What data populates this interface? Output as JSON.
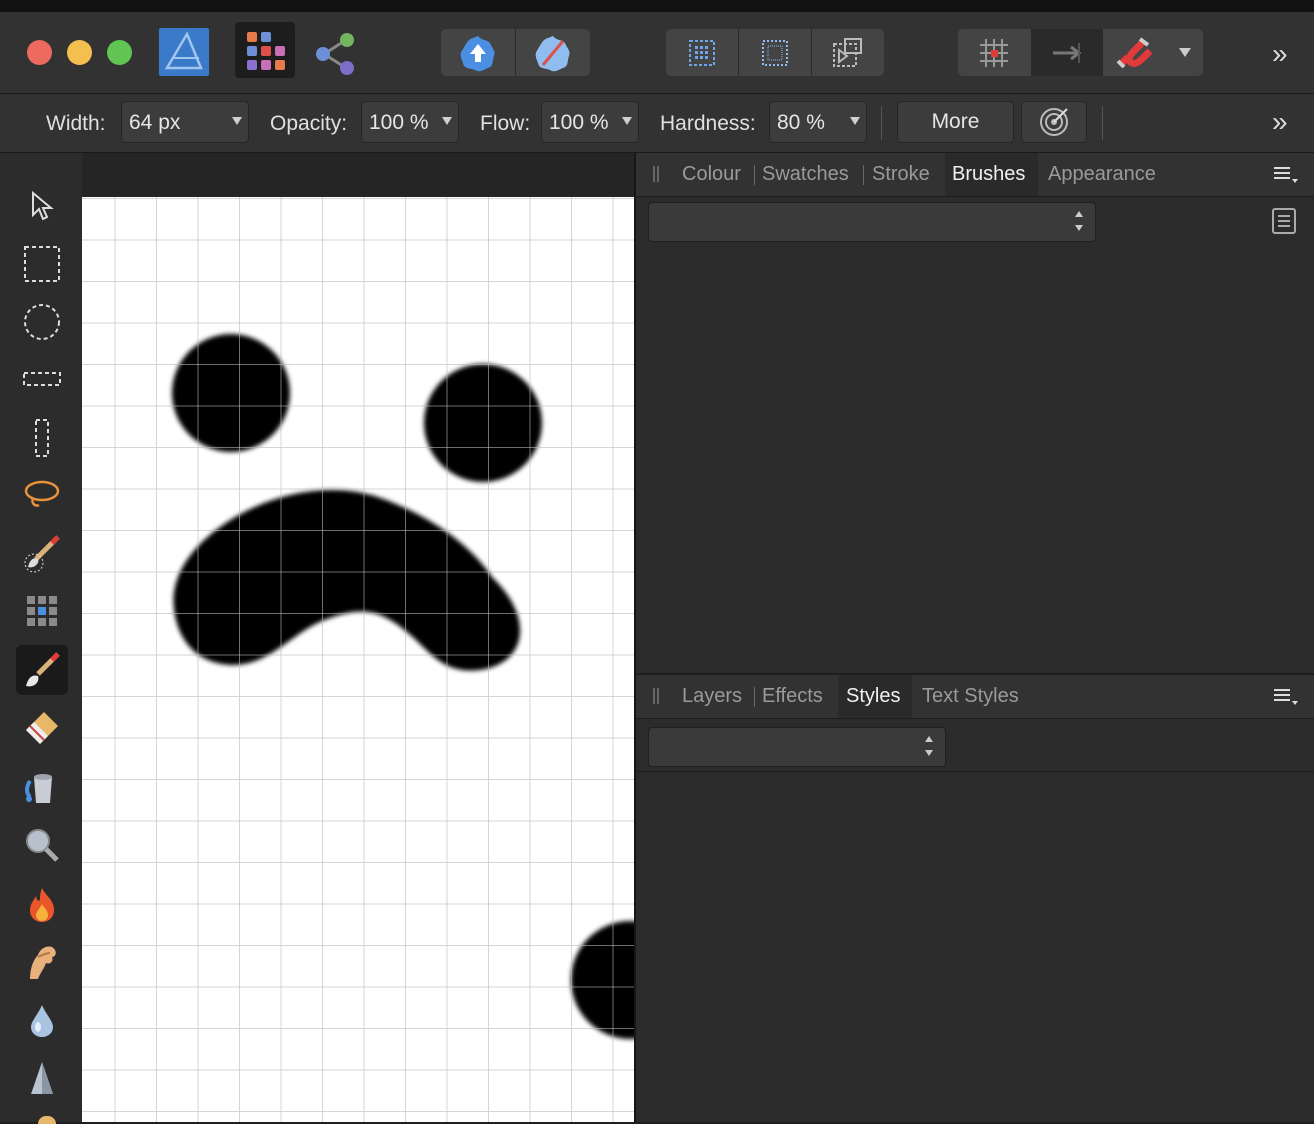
{
  "toolbar": {
    "icons": [
      "affinity-photo-logo-icon",
      "photo-persona-icon",
      "export-persona-icon",
      "assistant-icon",
      "quick-mask-icon",
      "selection-grid-icon",
      "selection-dotted-icon",
      "transform-selection-icon",
      "snapping-grid-icon",
      "snapping-arrow-icon",
      "snapping-magnet-icon",
      "snapping-options-dropdown",
      "toolbar-overflow-icon"
    ]
  },
  "context": {
    "width_label": "Width:",
    "width_value": "64 px",
    "opacity_label": "Opacity:",
    "opacity_value": "100 %",
    "flow_label": "Flow:",
    "flow_value": "100 %",
    "hardness_label": "Hardness:",
    "hardness_value": "80 %",
    "more_label": "More"
  },
  "panel_top": {
    "tabs": [
      {
        "label": "Colour"
      },
      {
        "label": "Swatches"
      },
      {
        "label": "Stroke"
      },
      {
        "label": "Brushes"
      },
      {
        "label": "Appearance"
      }
    ],
    "active_tab": "Brushes",
    "category_value": ""
  },
  "panel_bottom": {
    "tabs": [
      {
        "label": "Layers"
      },
      {
        "label": "Effects"
      },
      {
        "label": "Styles"
      },
      {
        "label": "Text Styles"
      }
    ],
    "active_tab": "Styles",
    "category_value": ""
  },
  "tools": [
    "move-tool-icon",
    "rectangular-marquee-icon",
    "elliptical-marquee-icon",
    "row-marquee-icon",
    "column-marquee-icon",
    "freehand-selection-icon",
    "selection-brush-icon",
    "flood-select-icon",
    "paint-brush-icon",
    "erase-brush-icon",
    "flood-fill-icon",
    "zoom-icon",
    "burn-brush-icon",
    "smudge-brush-icon",
    "blur-brush-icon",
    "sharpen-brush-icon"
  ],
  "colors": {
    "accent": "#4a8fe2",
    "active_tool_bg": "#1a1a1a",
    "close": "#ed6a5e",
    "minimize": "#f5bf4f",
    "maximize": "#61c554"
  }
}
